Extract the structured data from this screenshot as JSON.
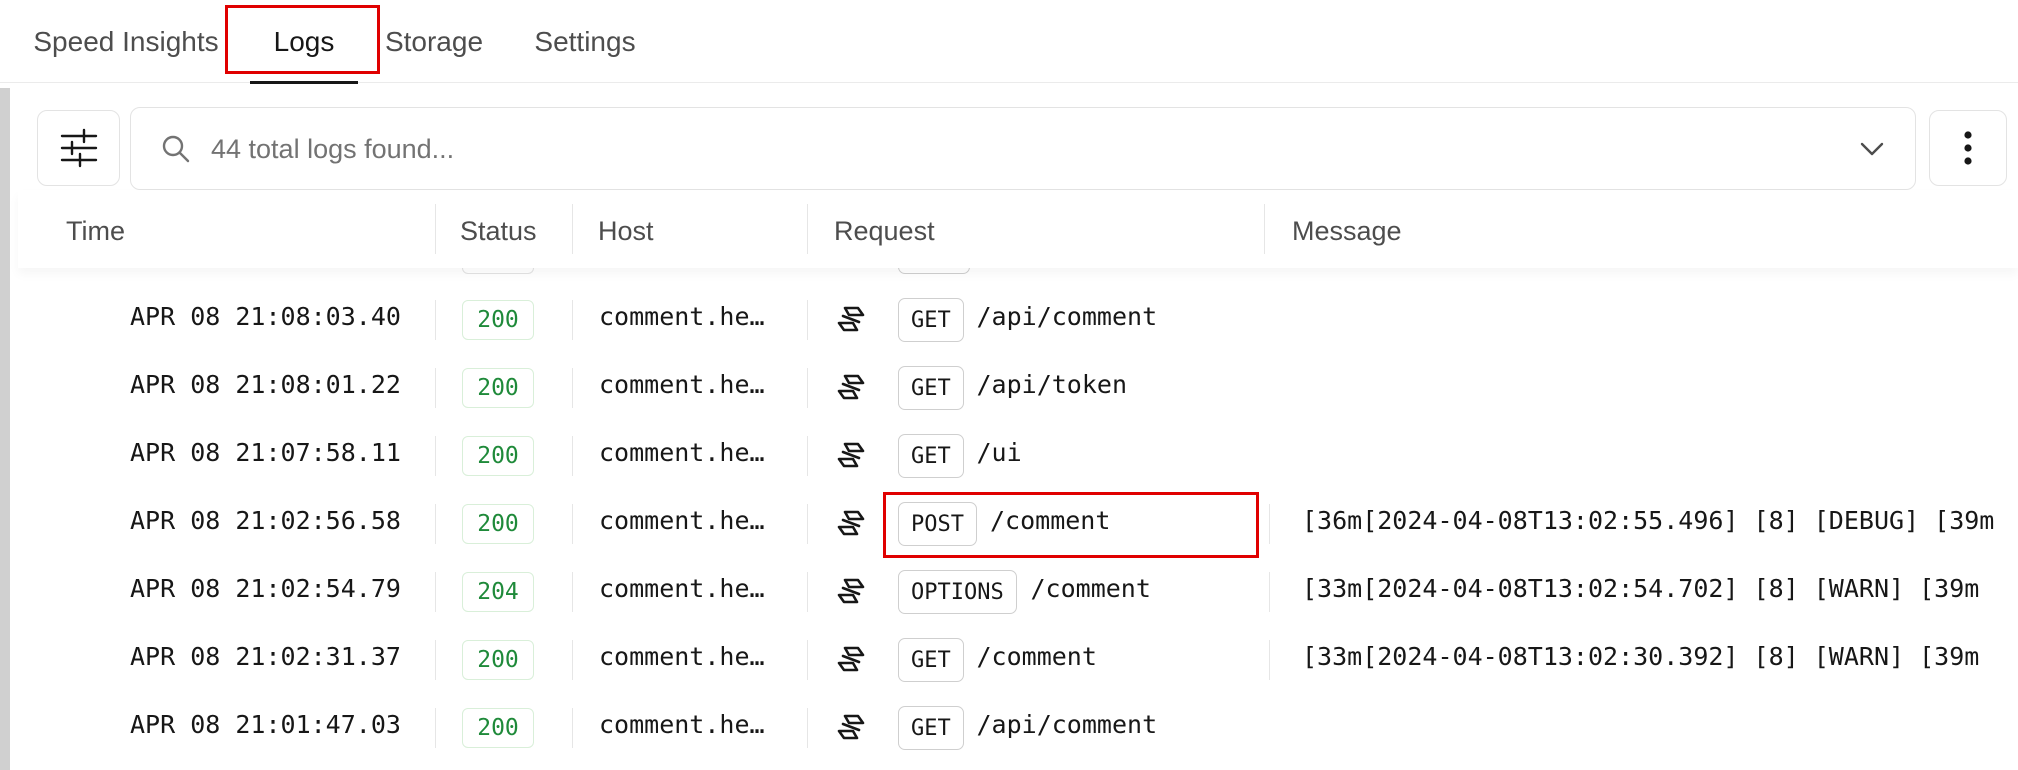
{
  "tabs": [
    {
      "label": "Speed Insights",
      "active": false
    },
    {
      "label": "Logs",
      "active": true
    },
    {
      "label": "Storage",
      "active": false
    },
    {
      "label": "Settings",
      "active": false
    }
  ],
  "search": {
    "placeholder": "44 total logs found..."
  },
  "table": {
    "columns": [
      "Time",
      "Status",
      "Host",
      "Request",
      "Message"
    ],
    "rows": [
      {
        "time": "APR 08 21:08:03.40",
        "status": "200",
        "host": "comment.he…",
        "method": "GET",
        "path": "/api/comment",
        "message": ""
      },
      {
        "time": "APR 08 21:08:01.22",
        "status": "200",
        "host": "comment.he…",
        "method": "GET",
        "path": "/api/token",
        "message": ""
      },
      {
        "time": "APR 08 21:07:58.11",
        "status": "200",
        "host": "comment.he…",
        "method": "GET",
        "path": "/ui",
        "message": ""
      },
      {
        "time": "APR 08 21:02:56.58",
        "status": "200",
        "host": "comment.he…",
        "method": "POST",
        "path": "/comment",
        "message": "[36m[2024-04-08T13:02:55.496] [8] [DEBUG] [39m"
      },
      {
        "time": "APR 08 21:02:54.79",
        "status": "204",
        "host": "comment.he…",
        "method": "OPTIONS",
        "path": "/comment",
        "message": "[33m[2024-04-08T13:02:54.702] [8] [WARN] [39m"
      },
      {
        "time": "APR 08 21:02:31.37",
        "status": "200",
        "host": "comment.he…",
        "method": "GET",
        "path": "/comment",
        "message": "[33m[2024-04-08T13:02:30.392] [8] [WARN] [39m"
      },
      {
        "time": "APR 08 21:01:47.03",
        "status": "200",
        "host": "comment.he…",
        "method": "GET",
        "path": "/api/comment",
        "message": ""
      }
    ]
  },
  "icons": {
    "filter": "sliders-icon",
    "search": "search-icon",
    "dropdown": "chevron-down-icon",
    "more": "more-vertical-icon",
    "function": "serverless-function-icon"
  },
  "colors": {
    "status_ok": "#1f8a3a",
    "highlight": "#e00000",
    "active_tab_underline": "#171717"
  }
}
